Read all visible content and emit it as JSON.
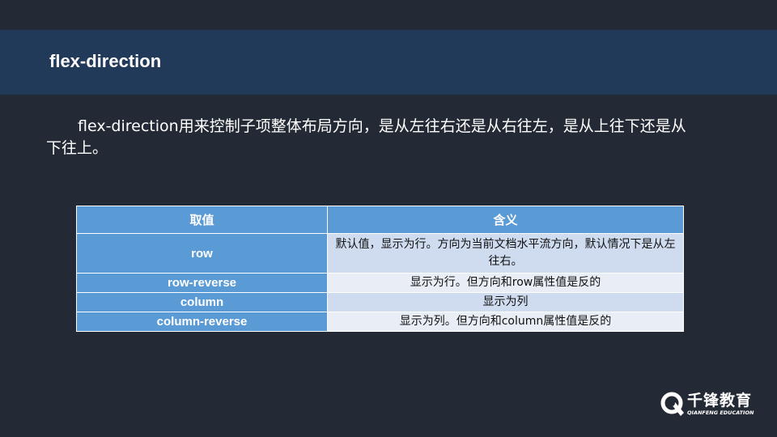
{
  "slide": {
    "title": "flex-direction",
    "description": "flex-direction用来控制子项整体布局方向，是从左往右还是从右往左，是从上往下还是从下往上。"
  },
  "table": {
    "headers": [
      "取值",
      "含义"
    ],
    "rows": [
      {
        "value": "row",
        "meaning": "默认值，显示为行。方向为当前文档水平流方向，默认情况下是从左往右。"
      },
      {
        "value": "row-reverse",
        "meaning": "显示为行。但方向和row属性值是反的"
      },
      {
        "value": "column",
        "meaning": "显示为列"
      },
      {
        "value": "column-reverse",
        "meaning": "显示为列。但方向和column属性值是反的"
      }
    ]
  },
  "logo": {
    "name_cn": "千锋教育",
    "name_en": "QIANFENG EDUCATION"
  },
  "colors": {
    "background": "#242a35",
    "title_bar": "#223a5a",
    "header_blue": "#5b9bd5",
    "row_odd": "#cfdbee",
    "row_even": "#e8edf6"
  }
}
